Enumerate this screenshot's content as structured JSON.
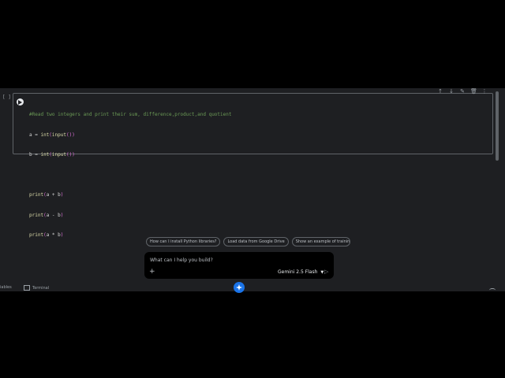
{
  "cell": {
    "bracket": "[ ]",
    "code": {
      "comment": "#Read two integers and print their sum, difference,product,and quotient",
      "line_a_var": "a = ",
      "line_b_var": "b = ",
      "int_fn": "int",
      "input_fn": "input",
      "print_fn": "print",
      "print1_args": "a + b",
      "print2_args": "a - b",
      "print3_args": "a * b"
    },
    "toolbar": [
      "arrow-up-icon",
      "arrow-down-icon",
      "sparkle-edit-icon",
      "delete-icon",
      "more-icon"
    ]
  },
  "chips": [
    "How can I install Python libraries?",
    "Load data from Google Drive",
    "Show an example of training a"
  ],
  "prompt": {
    "placeholder": "What can I help you build?",
    "model": "Gemini 2.5 Flash"
  },
  "statusbar": {
    "left_text": "iables",
    "terminal_label": "Terminal"
  }
}
